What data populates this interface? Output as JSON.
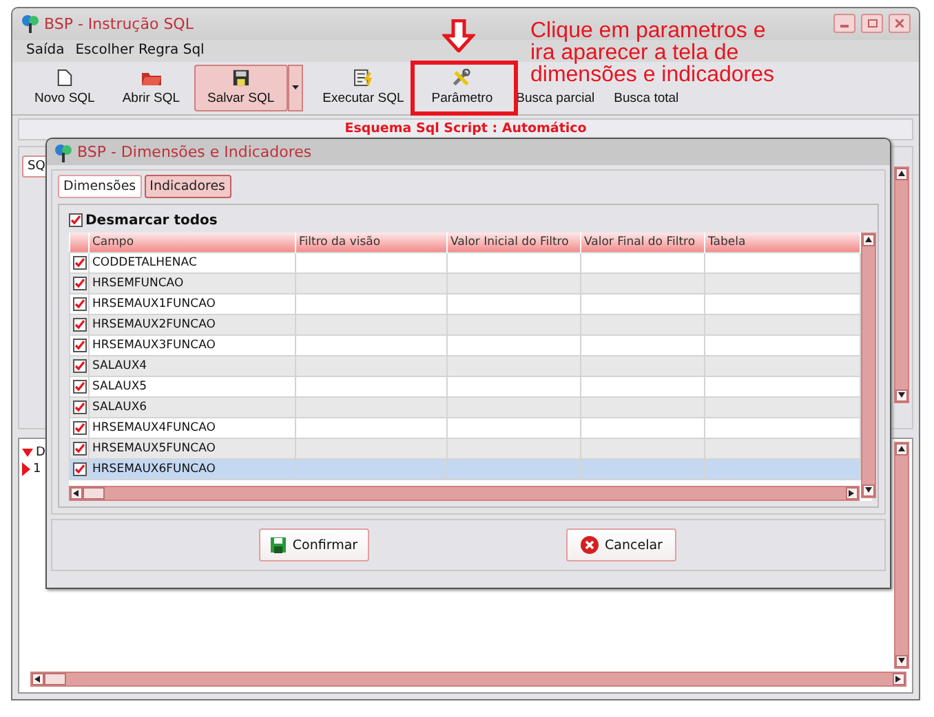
{
  "window": {
    "title": "BSP - Instrução SQL"
  },
  "menu": [
    {
      "label": "Saída"
    },
    {
      "label": "Escolher Regra Sql"
    }
  ],
  "toolbar": [
    {
      "label": "Novo SQL",
      "kind": "new",
      "selected": false
    },
    {
      "label": "Abrir SQL",
      "kind": "open",
      "selected": false
    },
    {
      "label": "Salvar SQL",
      "kind": "save",
      "selected": true
    },
    {
      "label": "Executar SQL",
      "kind": "run",
      "selected": false
    },
    {
      "label": "Parâmetro",
      "kind": "params",
      "selected": false
    },
    {
      "label": "Busca parcial",
      "kind": "search",
      "selected": false
    },
    {
      "label": "Busca total",
      "kind": "search",
      "selected": false
    }
  ],
  "schema_label": "Esquema Sql Script : Automático",
  "main_tab": {
    "label": "SQ"
  },
  "lower_grid": {
    "header": "D",
    "row": "1"
  },
  "dialog": {
    "title": "BSP - Dimensões e Indicadores",
    "tabs": [
      {
        "label": "Dimensões",
        "selected": false
      },
      {
        "label": "Indicadores",
        "selected": true
      }
    ],
    "uncheck_all": {
      "label": "Desmarcar todos",
      "checked": true
    },
    "columns": [
      "Campo",
      "Filtro da visão",
      "Valor Inicial do Filtro",
      "Valor Final do Filtro",
      "Tabela"
    ],
    "rows": [
      {
        "campo": "CODDETALHENAC",
        "checked": true,
        "selected": false
      },
      {
        "campo": "HRSEMFUNCAO",
        "checked": true,
        "selected": false
      },
      {
        "campo": "HRSEMAUX1FUNCAO",
        "checked": true,
        "selected": false
      },
      {
        "campo": "HRSEMAUX2FUNCAO",
        "checked": true,
        "selected": false
      },
      {
        "campo": "HRSEMAUX3FUNCAO",
        "checked": true,
        "selected": false
      },
      {
        "campo": "SALAUX4",
        "checked": true,
        "selected": false
      },
      {
        "campo": "SALAUX5",
        "checked": true,
        "selected": false
      },
      {
        "campo": "SALAUX6",
        "checked": true,
        "selected": false
      },
      {
        "campo": "HRSEMAUX4FUNCAO",
        "checked": true,
        "selected": false
      },
      {
        "campo": "HRSEMAUX5FUNCAO",
        "checked": true,
        "selected": false
      },
      {
        "campo": "HRSEMAUX6FUNCAO",
        "checked": true,
        "selected": true
      }
    ],
    "buttons": [
      {
        "label": "Confirmar",
        "kind": "confirm"
      },
      {
        "label": "Cancelar",
        "kind": "cancel"
      }
    ]
  },
  "annotation": {
    "text": "Clique em parametros e ira aparecer a tela de dimensões e indicadores"
  }
}
